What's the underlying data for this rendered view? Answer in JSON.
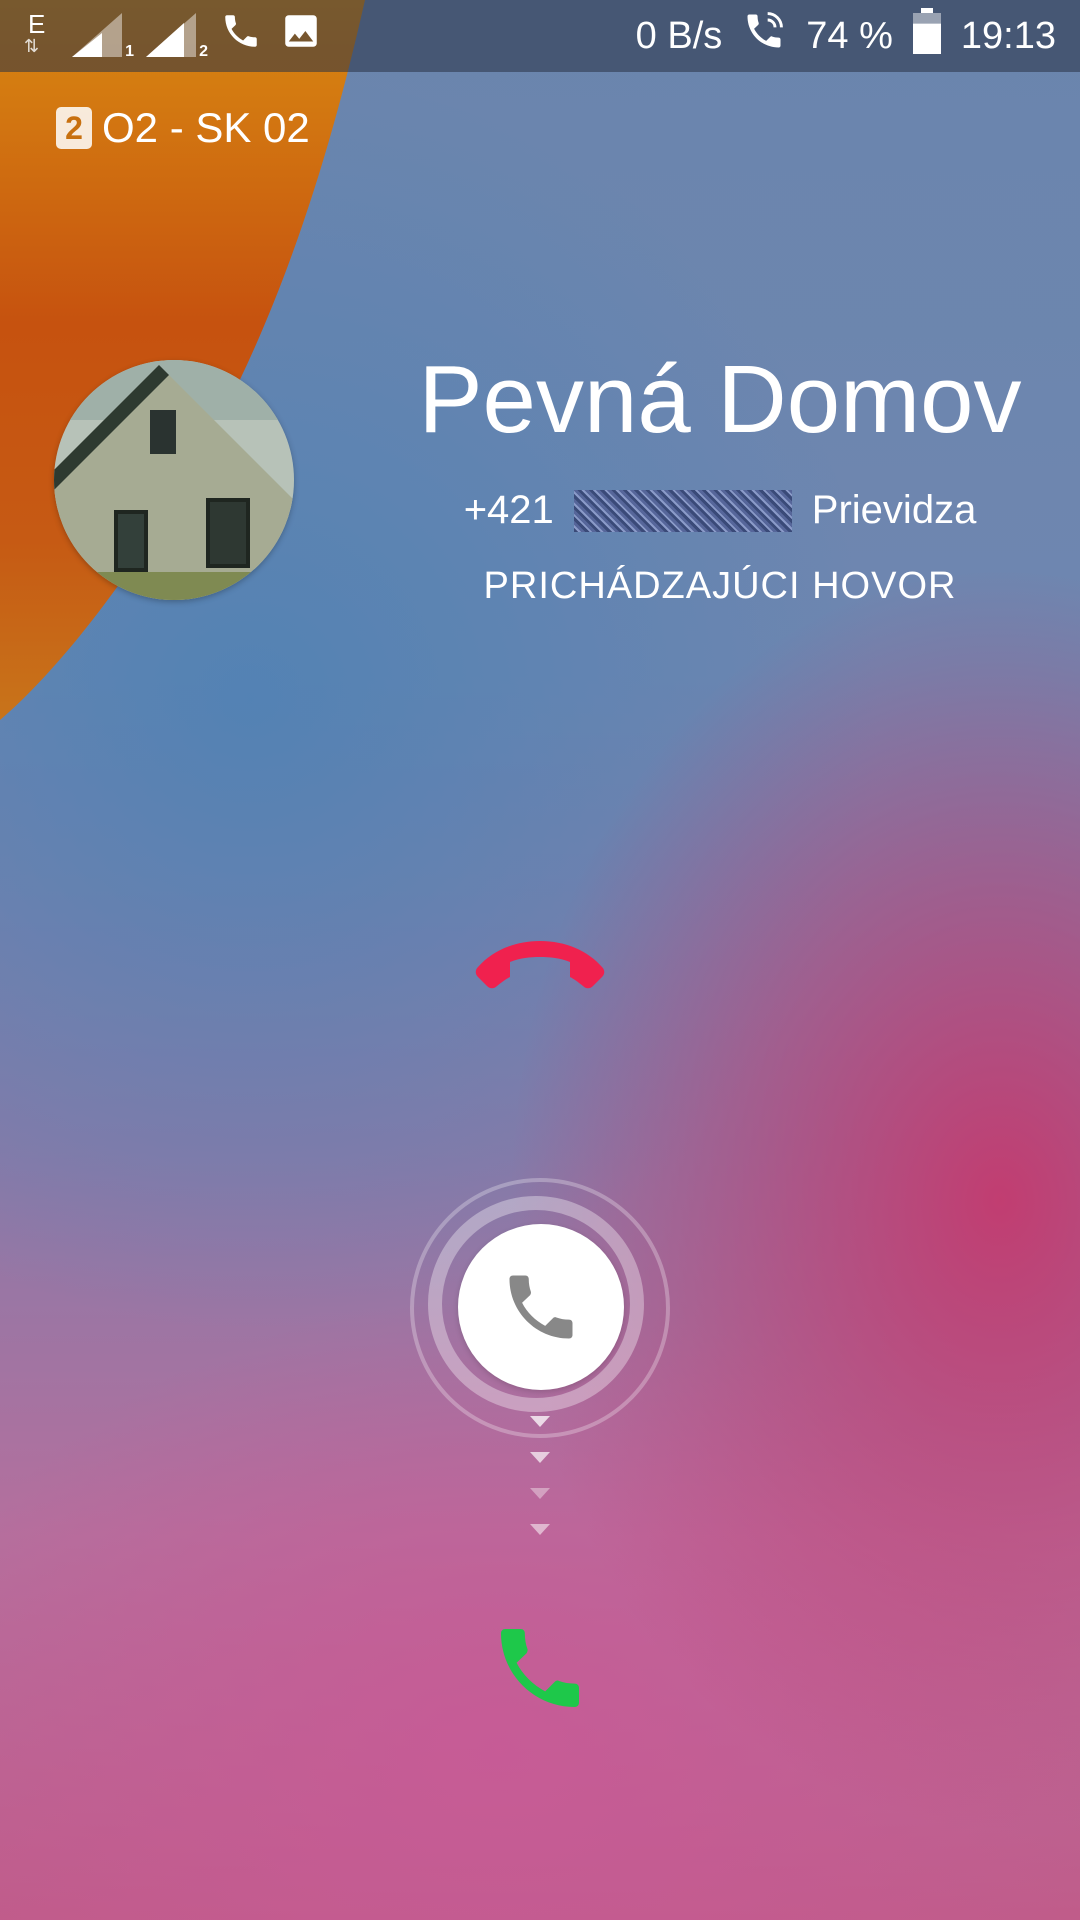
{
  "status_bar": {
    "network_type": "E",
    "sim1_label": "1",
    "sim2_label": "2",
    "data_speed": "0 B/s",
    "battery_percent": "74 %",
    "battery_level": 0.74,
    "time": "19:13",
    "icons": [
      "data-arrows-icon",
      "signal-sim1-icon",
      "signal-sim2-icon",
      "phone-icon",
      "image-icon",
      "wifi-calling-icon",
      "battery-icon"
    ]
  },
  "operator": {
    "sim_badge": "2",
    "name": "O2 - SK 02"
  },
  "caller": {
    "name": "Pevná Domov",
    "number_prefix": "+421",
    "location": "Prievidza",
    "status": "PRICHÁDZAJÚCI HOVOR",
    "avatar": "house-photo"
  },
  "actions": {
    "decline_icon": "hang-up-icon",
    "answer_icon": "phone-answer-icon",
    "handle_icon": "phone-icon"
  },
  "colors": {
    "decline": "#f0214e",
    "answer": "#1ec84a",
    "accent_orange": "#d4841a"
  }
}
